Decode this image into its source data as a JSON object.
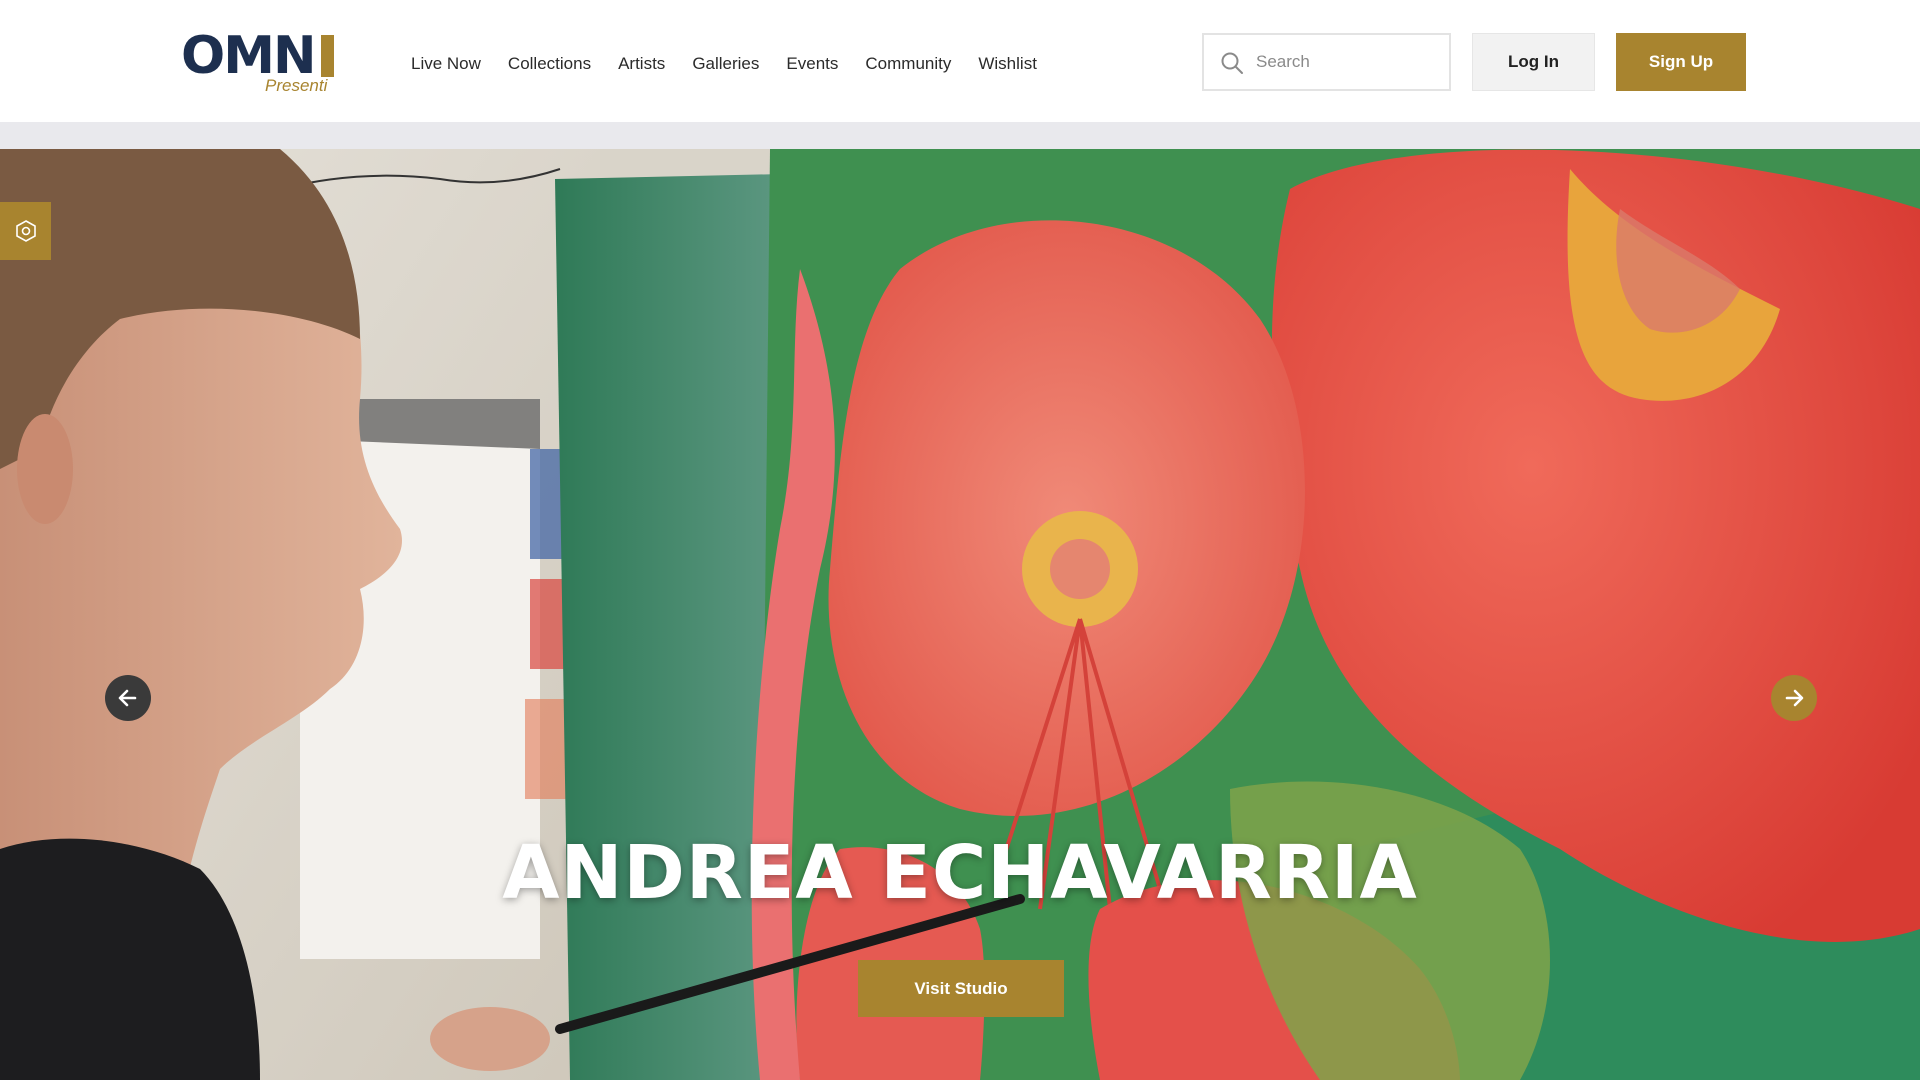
{
  "brand": {
    "logo_word": "OMN",
    "logo_sub": "Presenti",
    "accent_color": "#a8842f",
    "navy_color": "#1d2f4f"
  },
  "nav": {
    "items": [
      {
        "label": "Live Now"
      },
      {
        "label": "Collections"
      },
      {
        "label": "Artists"
      },
      {
        "label": "Galleries"
      },
      {
        "label": "Events"
      },
      {
        "label": "Community"
      },
      {
        "label": "Wishlist"
      }
    ]
  },
  "search": {
    "placeholder": "Search",
    "icon": "search-icon"
  },
  "auth": {
    "login_label": "Log In",
    "signup_label": "Sign Up"
  },
  "hero": {
    "artist_name": "ANDREA ECHAVARRIA",
    "cta_label": "Visit Studio",
    "prev_icon": "arrow-left-icon",
    "next_icon": "arrow-right-icon",
    "settings_icon": "hexagon-settings-icon"
  }
}
